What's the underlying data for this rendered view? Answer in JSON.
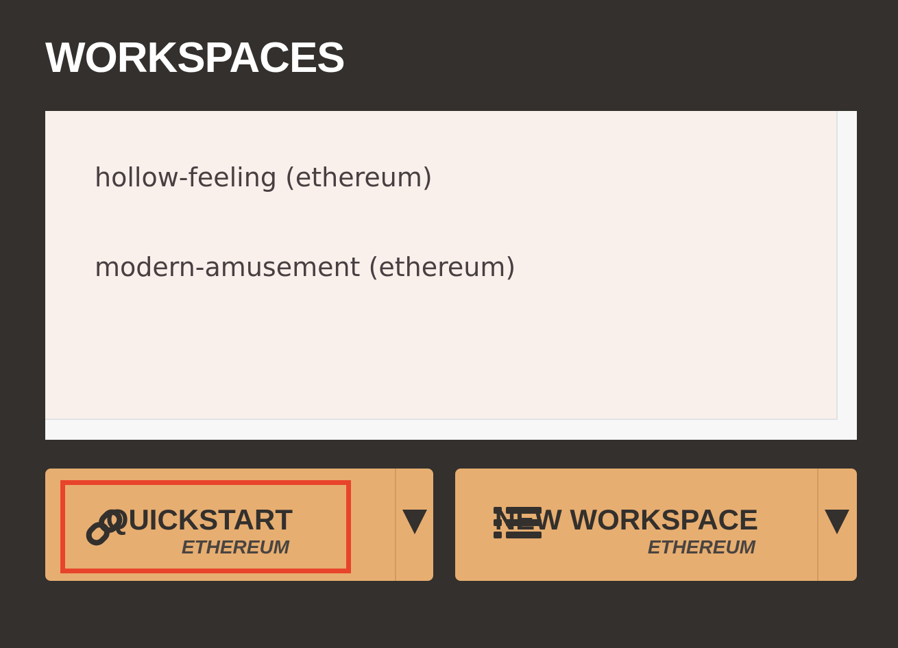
{
  "header": {
    "title": "WORKSPACES"
  },
  "workspaces": {
    "items": [
      {
        "label": "hollow-feeling (ethereum)"
      },
      {
        "label": "modern-amusement (ethereum)"
      }
    ]
  },
  "actions": {
    "quickstart": {
      "label": "QUICKSTART",
      "sublabel": "ETHEREUM",
      "icon": "link-icon",
      "highlighted": true
    },
    "new_workspace": {
      "label": "NEW WORKSPACE",
      "sublabel": "ETHEREUM",
      "icon": "list-icon"
    },
    "dropdown_icon": "caret-down-icon"
  },
  "colors": {
    "background": "#33302d",
    "panel": "#f9f0ec",
    "button": "#e7ae71",
    "highlight": "#e8442b"
  }
}
